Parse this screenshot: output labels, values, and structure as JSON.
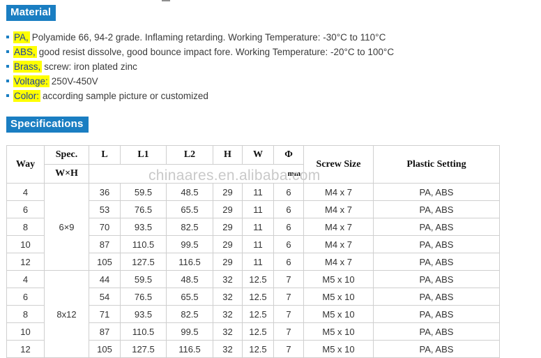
{
  "sections": {
    "material": {
      "badge_label": "Material",
      "bullets": [
        {
          "key": "PA,",
          "rest": "Polyamide 66, 94-2 grade. Inflaming retarding. Working Temperature:  -30°C to 110°C"
        },
        {
          "key": "ABS,",
          "rest": "good resist dissolve, good bounce impact fore. Working Temperature: -20°C to 100°C"
        },
        {
          "key": "Brass,",
          "rest": "screw:  iron plated zinc"
        },
        {
          "key": "Voltage:",
          "rest": "250V-450V"
        },
        {
          "key": "Color:",
          "rest": "according sample picture or customized"
        }
      ]
    },
    "specifications": {
      "badge_label": "Specifications",
      "table": {
        "headers": {
          "way": "Way",
          "spec": "Spec.",
          "spec_sub": "W×H",
          "l": "L",
          "l1": "L1",
          "l2": "L2",
          "h": "H",
          "w": "W",
          "phi": "Φ",
          "unit": "mm",
          "screw_size": "Screw Size",
          "plastic_setting": "Plastic Setting"
        },
        "groups": [
          {
            "spec": "6×9",
            "rows": [
              {
                "way": "4",
                "l": "36",
                "l1": "59.5",
                "l2": "48.5",
                "h": "29",
                "w": "11",
                "phi": "6",
                "screw": "M4 x 7",
                "plastic": "PA, ABS"
              },
              {
                "way": "6",
                "l": "53",
                "l1": "76.5",
                "l2": "65.5",
                "h": "29",
                "w": "11",
                "phi": "6",
                "screw": "M4 x 7",
                "plastic": "PA, ABS"
              },
              {
                "way": "8",
                "l": "70",
                "l1": "93.5",
                "l2": "82.5",
                "h": "29",
                "w": "11",
                "phi": "6",
                "screw": "M4 x 7",
                "plastic": "PA, ABS"
              },
              {
                "way": "10",
                "l": "87",
                "l1": "110.5",
                "l2": "99.5",
                "h": "29",
                "w": "11",
                "phi": "6",
                "screw": "M4 x 7",
                "plastic": "PA, ABS"
              },
              {
                "way": "12",
                "l": "105",
                "l1": "127.5",
                "l2": "116.5",
                "h": "29",
                "w": "11",
                "phi": "6",
                "screw": "M4 x 7",
                "plastic": "PA, ABS"
              }
            ]
          },
          {
            "spec": "8x12",
            "rows": [
              {
                "way": "4",
                "l": "44",
                "l1": "59.5",
                "l2": "48.5",
                "h": "32",
                "w": "12.5",
                "phi": "7",
                "screw": "M5 x 10",
                "plastic": "PA, ABS"
              },
              {
                "way": "6",
                "l": "54",
                "l1": "76.5",
                "l2": "65.5",
                "h": "32",
                "w": "12.5",
                "phi": "7",
                "screw": "M5 x 10",
                "plastic": "PA, ABS"
              },
              {
                "way": "8",
                "l": "71",
                "l1": "93.5",
                "l2": "82.5",
                "h": "32",
                "w": "12.5",
                "phi": "7",
                "screw": "M5 x 10",
                "plastic": "PA, ABS"
              },
              {
                "way": "10",
                "l": "87",
                "l1": "110.5",
                "l2": "99.5",
                "h": "32",
                "w": "12.5",
                "phi": "7",
                "screw": "M5 x 10",
                "plastic": "PA, ABS"
              },
              {
                "way": "12",
                "l": "105",
                "l1": "127.5",
                "l2": "116.5",
                "h": "32",
                "w": "12.5",
                "phi": "7",
                "screw": "M5 x 10",
                "plastic": "PA, ABS"
              }
            ]
          }
        ]
      }
    }
  },
  "watermark": {
    "text": "chinaares.en.alibaba.com"
  },
  "colors": {
    "badge_blue": "#1a7ec2",
    "highlight_yellow": "#ffff00",
    "highlight_text": "#1a3fa0",
    "body_text": "#3a3a3a",
    "table_border": "#cfcfcf",
    "watermark_gray": "#c9c9c9"
  }
}
